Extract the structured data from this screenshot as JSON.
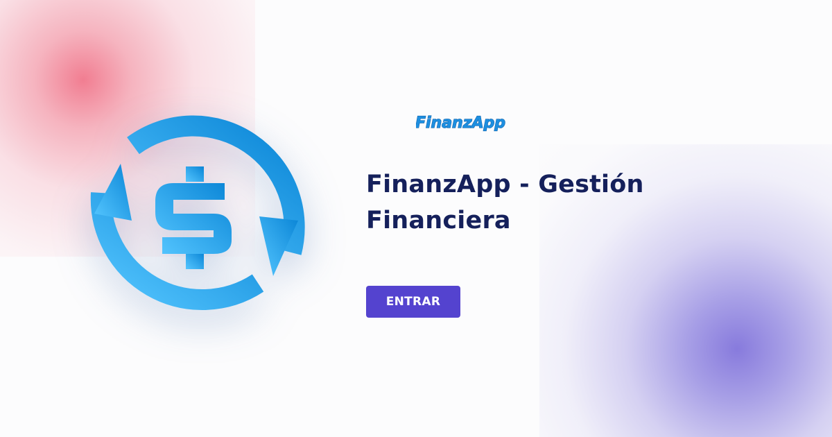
{
  "brand": {
    "logo_text": "FinanzApp",
    "logo_icon": "currency-exchange-icon"
  },
  "hero": {
    "title": "FinanzApp - Gestión Financiera"
  },
  "cta": {
    "enter_label": "ENTRAR"
  },
  "colors": {
    "title": "#15205b",
    "button": "#5443cf",
    "icon_light": "#4fc0ff",
    "icon_dark": "#0a85d6",
    "blob_pink": "#ee5a73",
    "blob_purple": "#7364d7"
  }
}
